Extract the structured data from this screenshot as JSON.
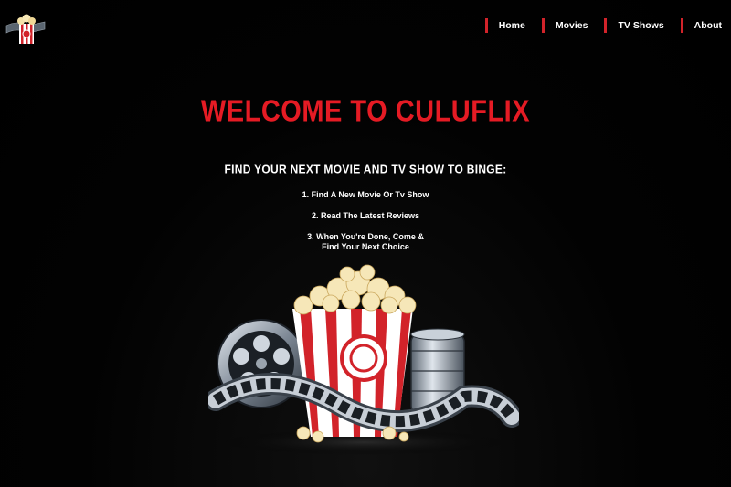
{
  "nav": {
    "items": [
      {
        "label": "Home"
      },
      {
        "label": "Movies"
      },
      {
        "label": "TV Shows"
      },
      {
        "label": "About"
      }
    ]
  },
  "hero": {
    "title": "WELCOME TO CULUFLIX",
    "subtitle": "FIND YOUR NEXT MOVIE AND TV SHOW TO BINGE:",
    "steps": [
      "1. Find A New Movie Or Tv Show",
      "2. Read The Latest Reviews",
      "3. When You're Done, Come &",
      "Find Your Next Choice"
    ]
  },
  "colors": {
    "accent": "#e51b24",
    "background": "#000000",
    "text": "#ffffff"
  },
  "icons": {
    "logo": "popcorn-film-logo-icon",
    "hero": "popcorn-film-reel-illustration"
  }
}
